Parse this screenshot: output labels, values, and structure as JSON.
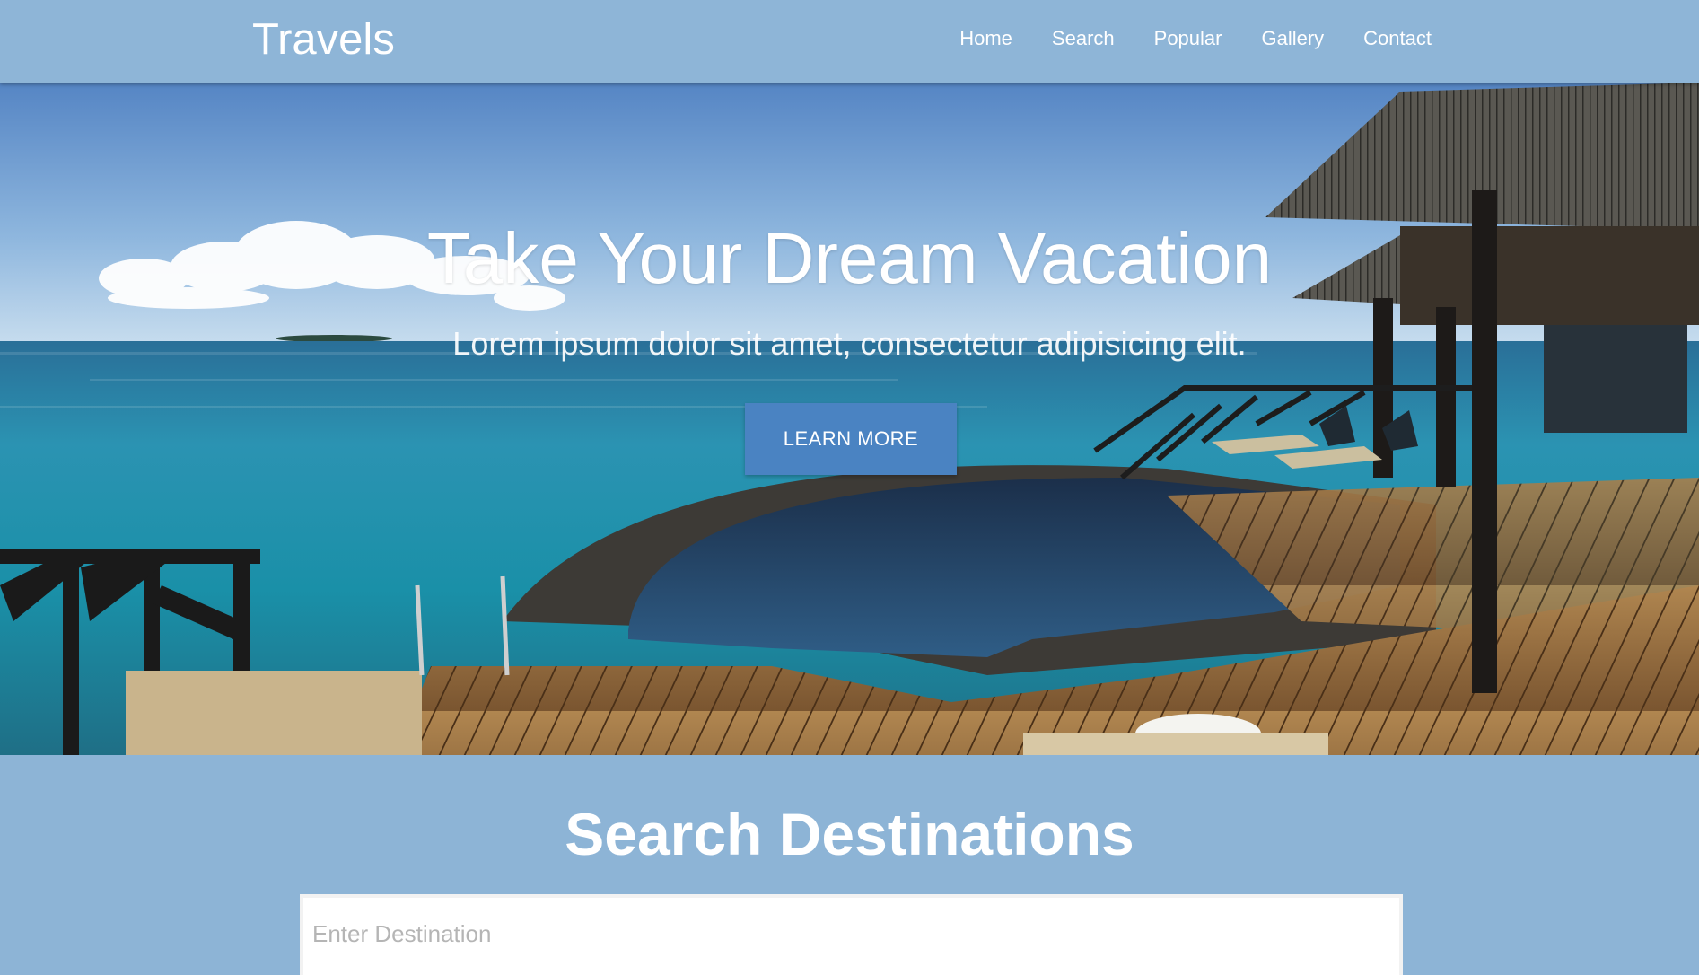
{
  "navbar": {
    "brand": "Travels",
    "links": [
      "Home",
      "Search",
      "Popular",
      "Gallery",
      "Contact"
    ]
  },
  "hero": {
    "title": "Take Your Dream Vacation",
    "subtitle": "Lorem ipsum dolor sit amet, consectetur adipisicing elit.",
    "button_label": "LEARN MORE"
  },
  "search": {
    "title": "Search Destinations",
    "placeholder": "Enter Destination"
  },
  "colors": {
    "navbar_bg": "#8eb5d7",
    "button_bg": "#4a83c2",
    "section_bg": "#8db4d6"
  }
}
